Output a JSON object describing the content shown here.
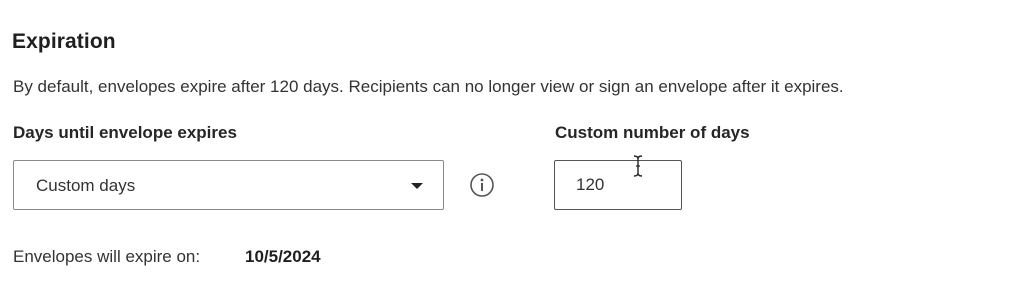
{
  "section": {
    "title": "Expiration",
    "description": "By default, envelopes expire after 120 days. Recipients can no longer view or sign an envelope after it expires."
  },
  "days_field": {
    "label": "Days until envelope expires",
    "selected": "Custom days",
    "caret_icon": "caret-down-icon",
    "info_icon": "info-icon"
  },
  "custom_field": {
    "label": "Custom number of days",
    "value": "120"
  },
  "expiry": {
    "label": "Envelopes will expire on:",
    "date": "10/5/2024"
  }
}
